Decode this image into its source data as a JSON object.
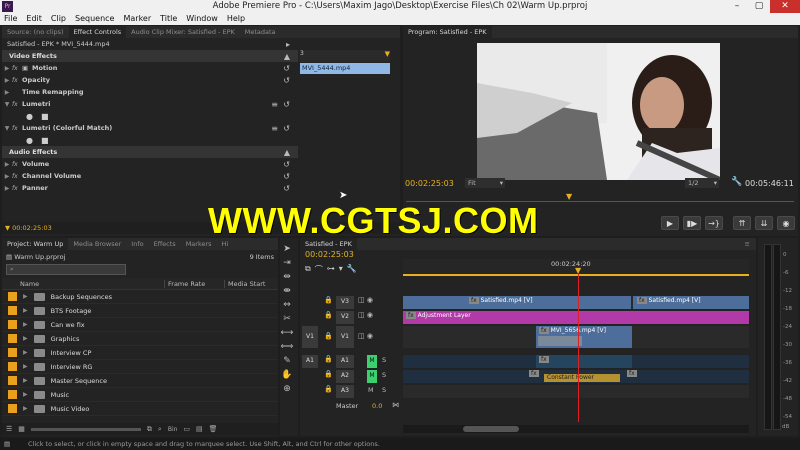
{
  "window": {
    "title": "Adobe Premiere Pro - C:\\Users\\Maxim Jago\\Desktop\\Exercise Files\\Ch 02\\Warm Up.prproj",
    "app_icon": "Pr",
    "controls": [
      "–",
      "▢",
      "✕"
    ]
  },
  "menu": [
    "File",
    "Edit",
    "Clip",
    "Sequence",
    "Marker",
    "Title",
    "Window",
    "Help"
  ],
  "source_panel": {
    "tabs": [
      "Source: (no clips)",
      "Effect Controls",
      "Audio Clip Mixer: Satisfied - EPK",
      "Metadata"
    ],
    "active_tab": "Effect Controls",
    "header": "Satisfied - EPK * MVI_5444.mp4",
    "mini_ruler": "3",
    "clip_name": "MVI_5444.mp4",
    "video_effects_label": "Video Effects",
    "audio_effects_label": "Audio Effects",
    "video_effects": [
      {
        "name": "Motion"
      },
      {
        "name": "Opacity"
      },
      {
        "name": "Time Remapping"
      },
      {
        "name": "Lumetri"
      },
      {
        "name": "Lumetri (Colorful Match)"
      }
    ],
    "audio_effects": [
      {
        "name": "Volume"
      },
      {
        "name": "Channel Volume"
      },
      {
        "name": "Panner"
      }
    ],
    "timecode": "00:02:25:03"
  },
  "program_monitor": {
    "tab": "Program: Satisfied - EPK",
    "timecode": "00:02:25:03",
    "fit": "Fit",
    "resolution": "1/2",
    "duration": "00:05:46:11"
  },
  "watermark": "WWW.CGTSJ.COM",
  "project_panel": {
    "tabs": [
      "Project: Warm Up",
      "Media Browser",
      "Info",
      "Effects",
      "Markers",
      "Hi"
    ],
    "filename": "Warm Up.prproj",
    "count": "9 Items",
    "columns": [
      "Name",
      "Frame Rate",
      "Media Start"
    ],
    "items": [
      "Backup Sequences",
      "BTS Footage",
      "Can we fix",
      "Graphics",
      "Interview CP",
      "Interview RG",
      "Master Sequence",
      "Music",
      "Music Video"
    ],
    "bin_label": "Bin"
  },
  "timeline": {
    "tab": "Satisfied - EPK",
    "timecode": "00:02:25:03",
    "ruler_time": "00:02:24:20",
    "tracks": {
      "v3": "V3",
      "v2": "V2",
      "v1": "V1",
      "v1_src": "V1",
      "a1": "A1",
      "a2": "A2",
      "a3": "A3",
      "a1_src": "A1",
      "master": "Master",
      "master_val": "0.0",
      "m": "M",
      "s": "S"
    },
    "clips": {
      "v3a": "Satisfied.mp4 [V]",
      "v3b": "Satisfied.mp4 [V]",
      "adj": "Adjustment Layer",
      "v1": "MVI_5656.mp4 [V]",
      "a2": "Constant Power",
      "fx": "fx"
    },
    "meter_labels": [
      "0",
      "-6",
      "-12",
      "-18",
      "-24",
      "-30",
      "-36",
      "-42",
      "-48",
      "-54"
    ],
    "meter_db": "dB"
  },
  "status_bar": "Click to select, or click in empty space and drag to marquee select. Use Shift, Alt, and Ctrl for other options.",
  "colors": {
    "accent_yellow": "#e8b020",
    "adjustment_layer": "#b13aa8",
    "video_clip": "#4d6e9a",
    "audio_green": "#3bd16f",
    "playhead": "#e02020"
  }
}
